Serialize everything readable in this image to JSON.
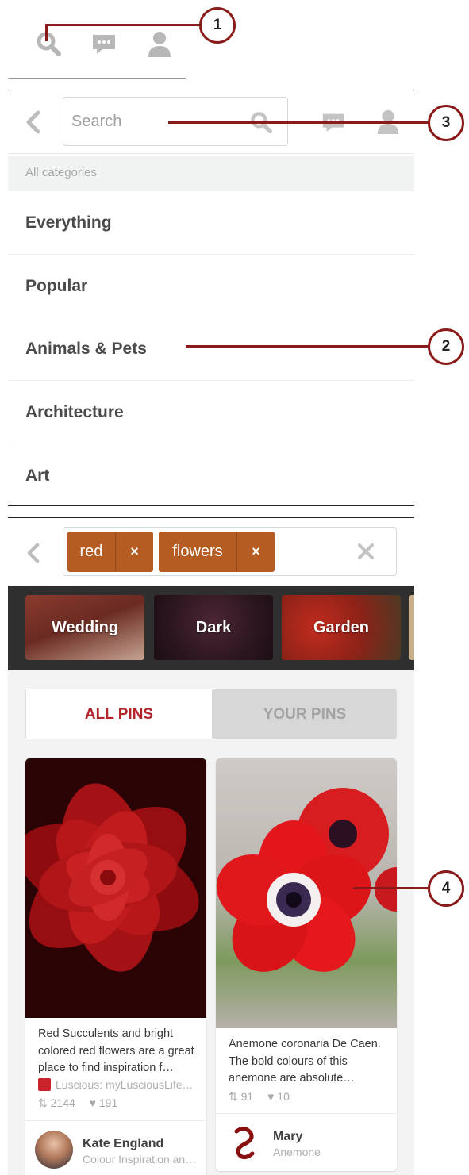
{
  "section1": {
    "icons": [
      "search-icon",
      "messages-icon",
      "profile-icon"
    ]
  },
  "search": {
    "placeholder": "Search"
  },
  "categories": {
    "header": "All categories",
    "items": [
      "Everything",
      "Popular",
      "Animals & Pets",
      "Architecture",
      "Art"
    ]
  },
  "tags": {
    "items": [
      "red",
      "flowers"
    ],
    "remove_glyph": "×"
  },
  "guides": [
    "Wedding",
    "Dark",
    "Garden"
  ],
  "tabs": {
    "all": "ALL PINS",
    "yours": "YOUR PINS"
  },
  "pins": [
    {
      "description": "Red Succulents and bright colored red flowers are a great place to find inspiration f…",
      "source": "Luscious: myLusciousLife…",
      "repins": "2144",
      "likes": "191",
      "user": "Kate England",
      "board": "Colour Inspiration an…"
    },
    {
      "description": "Anemone coronaria De Caen. The bold colours of this anemone are absolute…",
      "repins": "91",
      "likes": "10",
      "user": "Mary",
      "board": "Anemone"
    }
  ],
  "callouts": [
    "1",
    "2",
    "3",
    "4"
  ],
  "colors": {
    "accent": "#b3242a",
    "tag": "#b45c21",
    "callout": "#8b1a1a"
  }
}
